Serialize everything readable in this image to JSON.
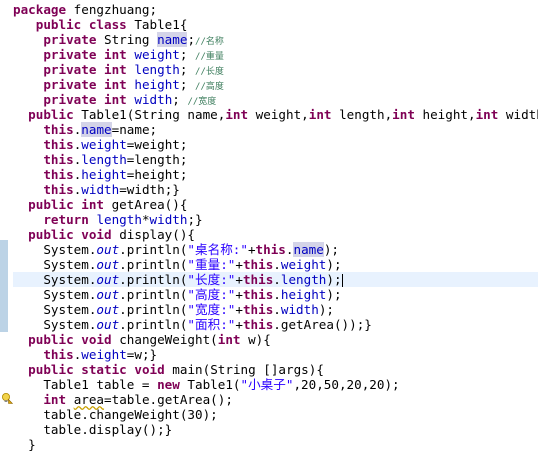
{
  "editor": {
    "lines": [
      {
        "indent": "",
        "tokens": [
          {
            "t": "package",
            "c": "kw"
          },
          {
            "t": " fengzhuang;"
          }
        ]
      },
      {
        "indent": "   ",
        "tokens": [
          {
            "t": "public",
            "c": "kw"
          },
          {
            "t": " "
          },
          {
            "t": "class",
            "c": "kw"
          },
          {
            "t": " Table1{"
          }
        ]
      },
      {
        "indent": "    ",
        "tokens": [
          {
            "t": "private",
            "c": "kw"
          },
          {
            "t": " String "
          },
          {
            "t": "name",
            "c": "fld occ"
          },
          {
            "t": ";"
          },
          {
            "t": "//名称",
            "c": "com"
          }
        ]
      },
      {
        "indent": "    ",
        "tokens": [
          {
            "t": "private",
            "c": "kw"
          },
          {
            "t": " "
          },
          {
            "t": "int",
            "c": "kw"
          },
          {
            "t": " "
          },
          {
            "t": "weight",
            "c": "fld"
          },
          {
            "t": "; "
          },
          {
            "t": "//重量",
            "c": "com"
          }
        ]
      },
      {
        "indent": "    ",
        "tokens": [
          {
            "t": "private",
            "c": "kw"
          },
          {
            "t": " "
          },
          {
            "t": "int",
            "c": "kw"
          },
          {
            "t": " "
          },
          {
            "t": "length",
            "c": "fld"
          },
          {
            "t": "; "
          },
          {
            "t": "//长度",
            "c": "com"
          }
        ]
      },
      {
        "indent": "    ",
        "tokens": [
          {
            "t": "private",
            "c": "kw"
          },
          {
            "t": " "
          },
          {
            "t": "int",
            "c": "kw"
          },
          {
            "t": " "
          },
          {
            "t": "height",
            "c": "fld"
          },
          {
            "t": "; "
          },
          {
            "t": "//高度",
            "c": "com"
          }
        ]
      },
      {
        "indent": "    ",
        "tokens": [
          {
            "t": "private",
            "c": "kw"
          },
          {
            "t": " "
          },
          {
            "t": "int",
            "c": "kw"
          },
          {
            "t": " "
          },
          {
            "t": "width",
            "c": "fld"
          },
          {
            "t": "; "
          },
          {
            "t": "//宽度",
            "c": "com"
          }
        ]
      },
      {
        "indent": "  ",
        "tokens": [
          {
            "t": "public",
            "c": "kw"
          },
          {
            "t": " Table1(String name,"
          },
          {
            "t": "int",
            "c": "kw"
          },
          {
            "t": " weight,"
          },
          {
            "t": "int",
            "c": "kw"
          },
          {
            "t": " length,"
          },
          {
            "t": "int",
            "c": "kw"
          },
          {
            "t": " height,"
          },
          {
            "t": "int",
            "c": "kw"
          },
          {
            "t": " width){"
          }
        ]
      },
      {
        "indent": "    ",
        "tokens": [
          {
            "t": "this",
            "c": "kw"
          },
          {
            "t": "."
          },
          {
            "t": "name",
            "c": "fld occ"
          },
          {
            "t": "=name;"
          }
        ]
      },
      {
        "indent": "    ",
        "tokens": [
          {
            "t": "this",
            "c": "kw"
          },
          {
            "t": "."
          },
          {
            "t": "weight",
            "c": "fld"
          },
          {
            "t": "=weight;"
          }
        ]
      },
      {
        "indent": "    ",
        "tokens": [
          {
            "t": "this",
            "c": "kw"
          },
          {
            "t": "."
          },
          {
            "t": "length",
            "c": "fld"
          },
          {
            "t": "=length;"
          }
        ]
      },
      {
        "indent": "    ",
        "tokens": [
          {
            "t": "this",
            "c": "kw"
          },
          {
            "t": "."
          },
          {
            "t": "height",
            "c": "fld"
          },
          {
            "t": "=height;"
          }
        ]
      },
      {
        "indent": "    ",
        "tokens": [
          {
            "t": "this",
            "c": "kw"
          },
          {
            "t": "."
          },
          {
            "t": "width",
            "c": "fld"
          },
          {
            "t": "=width;}"
          }
        ]
      },
      {
        "indent": "  ",
        "tokens": [
          {
            "t": "public",
            "c": "kw"
          },
          {
            "t": " "
          },
          {
            "t": "int",
            "c": "kw"
          },
          {
            "t": " getArea(){"
          }
        ]
      },
      {
        "indent": "    ",
        "tokens": [
          {
            "t": "return",
            "c": "kw"
          },
          {
            "t": " "
          },
          {
            "t": "length",
            "c": "fld"
          },
          {
            "t": "*"
          },
          {
            "t": "width",
            "c": "fld"
          },
          {
            "t": ";}"
          }
        ]
      },
      {
        "indent": "  ",
        "tokens": [
          {
            "t": "public",
            "c": "kw"
          },
          {
            "t": " "
          },
          {
            "t": "void",
            "c": "kw"
          },
          {
            "t": " display(){"
          }
        ]
      },
      {
        "indent": "    ",
        "tokens": [
          {
            "t": "System."
          },
          {
            "t": "out",
            "c": "st"
          },
          {
            "t": ".println("
          },
          {
            "t": "\"桌名称:\"",
            "c": "str"
          },
          {
            "t": "+"
          },
          {
            "t": "this",
            "c": "kw"
          },
          {
            "t": "."
          },
          {
            "t": "name",
            "c": "fld occ"
          },
          {
            "t": ");"
          }
        ]
      },
      {
        "indent": "    ",
        "tokens": [
          {
            "t": "System."
          },
          {
            "t": "out",
            "c": "st"
          },
          {
            "t": ".println("
          },
          {
            "t": "\"重量:\"",
            "c": "str"
          },
          {
            "t": "+"
          },
          {
            "t": "this",
            "c": "kw"
          },
          {
            "t": "."
          },
          {
            "t": "weight",
            "c": "fld"
          },
          {
            "t": ");"
          }
        ]
      },
      {
        "indent": "    ",
        "current": true,
        "tokens": [
          {
            "t": "System."
          },
          {
            "t": "out",
            "c": "st"
          },
          {
            "t": ".println("
          },
          {
            "t": "\"长度:\"",
            "c": "str"
          },
          {
            "t": "+"
          },
          {
            "t": "this",
            "c": "kw"
          },
          {
            "t": "."
          },
          {
            "t": "length",
            "c": "fld"
          },
          {
            "t": ");"
          },
          {
            "t": "",
            "c": "cursor"
          }
        ]
      },
      {
        "indent": "    ",
        "tokens": [
          {
            "t": "System."
          },
          {
            "t": "out",
            "c": "st"
          },
          {
            "t": ".println("
          },
          {
            "t": "\"高度:\"",
            "c": "str"
          },
          {
            "t": "+"
          },
          {
            "t": "this",
            "c": "kw"
          },
          {
            "t": "."
          },
          {
            "t": "height",
            "c": "fld"
          },
          {
            "t": ");"
          }
        ]
      },
      {
        "indent": "    ",
        "tokens": [
          {
            "t": "System."
          },
          {
            "t": "out",
            "c": "st"
          },
          {
            "t": ".println("
          },
          {
            "t": "\"宽度:\"",
            "c": "str"
          },
          {
            "t": "+"
          },
          {
            "t": "this",
            "c": "kw"
          },
          {
            "t": "."
          },
          {
            "t": "width",
            "c": "fld"
          },
          {
            "t": ");"
          }
        ]
      },
      {
        "indent": "    ",
        "tokens": [
          {
            "t": "System."
          },
          {
            "t": "out",
            "c": "st"
          },
          {
            "t": ".println("
          },
          {
            "t": "\"面积:\"",
            "c": "str"
          },
          {
            "t": "+"
          },
          {
            "t": "this",
            "c": "kw"
          },
          {
            "t": ".getArea());}"
          }
        ]
      },
      {
        "indent": "  ",
        "tokens": [
          {
            "t": "public",
            "c": "kw"
          },
          {
            "t": " "
          },
          {
            "t": "void",
            "c": "kw"
          },
          {
            "t": " changeWeight("
          },
          {
            "t": "int",
            "c": "kw"
          },
          {
            "t": " w){"
          }
        ]
      },
      {
        "indent": "    ",
        "tokens": [
          {
            "t": "this",
            "c": "kw"
          },
          {
            "t": "."
          },
          {
            "t": "weight",
            "c": "fld"
          },
          {
            "t": "=w;}"
          }
        ]
      },
      {
        "indent": "  ",
        "tokens": [
          {
            "t": "public",
            "c": "kw"
          },
          {
            "t": " "
          },
          {
            "t": "static",
            "c": "kw"
          },
          {
            "t": " "
          },
          {
            "t": "void",
            "c": "kw"
          },
          {
            "t": " main(String []args){"
          }
        ]
      },
      {
        "indent": "    ",
        "tokens": [
          {
            "t": "Table1 table = "
          },
          {
            "t": "new",
            "c": "kw"
          },
          {
            "t": " Table1("
          },
          {
            "t": "\"小桌子\"",
            "c": "str"
          },
          {
            "t": ",20,50,20,20);"
          }
        ]
      },
      {
        "indent": "    ",
        "tokens": [
          {
            "t": "int",
            "c": "kw"
          },
          {
            "t": " "
          },
          {
            "t": "area",
            "c": "underline-warn"
          },
          {
            "t": "=table.getArea();"
          }
        ]
      },
      {
        "indent": "    ",
        "tokens": [
          {
            "t": "table.changeWeight(30);"
          }
        ]
      },
      {
        "indent": "    ",
        "tokens": [
          {
            "t": "table.display();}"
          }
        ]
      },
      {
        "indent": "  ",
        "tokens": [
          {
            "t": "}"
          }
        ]
      }
    ]
  },
  "gutter": {
    "warning_icon": "warning-lightbulb-icon"
  }
}
